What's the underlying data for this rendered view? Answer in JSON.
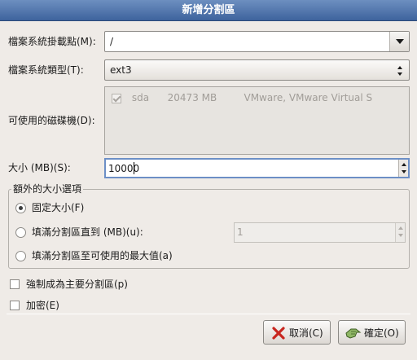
{
  "dialog": {
    "title": "新增分割區"
  },
  "mountpoint": {
    "label": "檔案系統掛載點(M):",
    "value": "/"
  },
  "fstype": {
    "label": "檔案系統類型(T):",
    "value": "ext3"
  },
  "drives": {
    "label": "可使用的磁碟機(D):",
    "rows": [
      {
        "checked": true,
        "name": "sda",
        "size": "20473 MB",
        "model": "VMware, VMware Virtual S"
      }
    ]
  },
  "size": {
    "label": "大小 (MB)(S):",
    "value": "10000"
  },
  "additional_size": {
    "legend": "額外的大小選項",
    "options": [
      {
        "label": "固定大小(F)",
        "checked": true
      },
      {
        "label": "填滿分割區直到 (MB)(u):",
        "checked": false
      },
      {
        "label": "填滿分割區至可使用的最大值(a)",
        "checked": false
      }
    ],
    "fill_until_value": "1"
  },
  "force_primary": {
    "label": "強制成為主要分割區(p)",
    "checked": false
  },
  "encrypt": {
    "label": "加密(E)",
    "checked": false
  },
  "buttons": {
    "cancel": "取消(C)",
    "ok": "確定(O)"
  },
  "colors": {
    "titlebar": "#4a6fa5",
    "window_bg": "#efebe7",
    "focus": "#6c8fc6"
  }
}
